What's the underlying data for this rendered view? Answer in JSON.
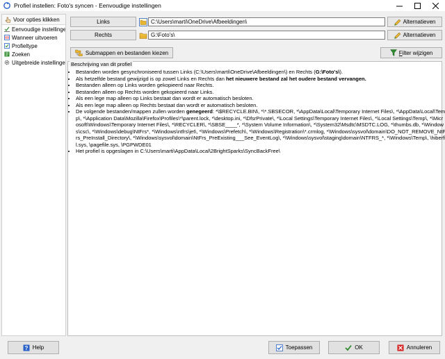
{
  "window": {
    "title": "Profiel instellen: Foto's syncen - Eenvoudige instellingen"
  },
  "sidebar": {
    "header": "Voor opties klikken",
    "items": [
      {
        "label": "Eenvoudige instellingen",
        "icon": "gear-check-icon"
      },
      {
        "label": "Wanneer uitvoeren",
        "icon": "clock-icon"
      },
      {
        "label": "Profieltype",
        "icon": "checkbox-icon"
      },
      {
        "label": "Zoeken",
        "icon": "tree-icon"
      },
      {
        "label": "Uitgebreide instellingen",
        "icon": "gear-icon"
      }
    ]
  },
  "paths": {
    "left_label": "Links",
    "left_value": "C:\\Users\\marti\\OneDrive\\Afbeeldingen\\",
    "right_label": "Rechts",
    "right_value": "G:\\Foto's\\",
    "alternatives_label": "Alternatieven"
  },
  "actions": {
    "subfolders_label": "Submappen en bestanden kiezen",
    "filter_label": "Filter wijzigen"
  },
  "description": {
    "label": "Beschrijving van dit profiel",
    "lines": [
      {
        "text": "Bestanden worden gesynchroniseerd tussen Links (C:\\Users\\marti\\OneDrive\\Afbeeldingen\\) en Rechts (",
        "bold": "G:\\Foto's\\",
        "after": ")."
      },
      {
        "text": "Als hetzelfde bestand gewijzigd is op zowel Links en Rechts dan ",
        "bold": "het nieuwere bestand zal het oudere bestand vervangen.",
        "after": ""
      },
      {
        "text": "Bestanden alleen op Links worden gekopieerd naar Rechts.",
        "bold": "",
        "after": ""
      },
      {
        "text": "Bestanden alleen op Rechts worden gekopieerd naar Links.",
        "bold": "",
        "after": ""
      },
      {
        "text": "Als een lege map alleen op Links bestaat dan wordt er automatisch besloten.",
        "bold": "",
        "after": ""
      },
      {
        "text": "Als een lege map alleen op Rechts bestaat dan wordt er automatisch besloten.",
        "bold": "",
        "after": ""
      },
      {
        "text": "De volgende bestanden/mappen zullen worden ",
        "bold": "genegeerd",
        "after": ": *\\$RECYCLE.BIN\\, *\\*.SBSECOR, *\\AppData\\Local\\Temporary Internet Files\\, *\\AppData\\Local\\Temp\\, *\\Application Data\\Mozilla\\Firefox\\Profiles\\*\\parent.lock, *\\desktop.ini, *\\DfsrPrivate\\, *\\Local Settings\\Temporary Internet Files\\, *\\Local Settings\\Temp\\, *\\Microsoft\\Windows\\Temporary Internet Files\\, *\\RECYCLER\\, *\\SBSE____*, *\\System Volume Information\\, *\\System32\\Msdtc\\MSDTC.LOG, *\\thumbs.db, *\\Windows\\csc\\, *\\Windows\\debug\\NtFrs*, *\\Windows\\ntfrs\\jet\\, *\\Windows\\Prefetch\\, *\\Windows\\Registration\\*.crmlog, *\\Windows\\sysvol\\domain\\DO_NOT_REMOVE_NtFrs_PreInstall_Directory\\, *\\Windows\\sysvol\\domain\\NtFrs_PreExisting___See_EventLog\\, *\\Windows\\sysvol\\staging\\domain\\NTFRS_*, *\\Windows\\Temp\\, \\hiberfil.sys, \\pagefile.sys, \\PGPWDE01"
      },
      {
        "text": "Het profiel is opgeslagen in C:\\Users\\marti\\AppData\\Local\\2BrightSparks\\SyncBackFree\\",
        "bold": "",
        "after": ""
      }
    ]
  },
  "footer": {
    "help_label": "Help",
    "apply_label": "Toepassen",
    "ok_label": "OK",
    "cancel_label": "Annuleren"
  },
  "colors": {
    "folder": "#e8b530",
    "ok_green": "#2e8b2e",
    "cancel_red": "#d32020",
    "help_blue": "#2a62c9"
  }
}
